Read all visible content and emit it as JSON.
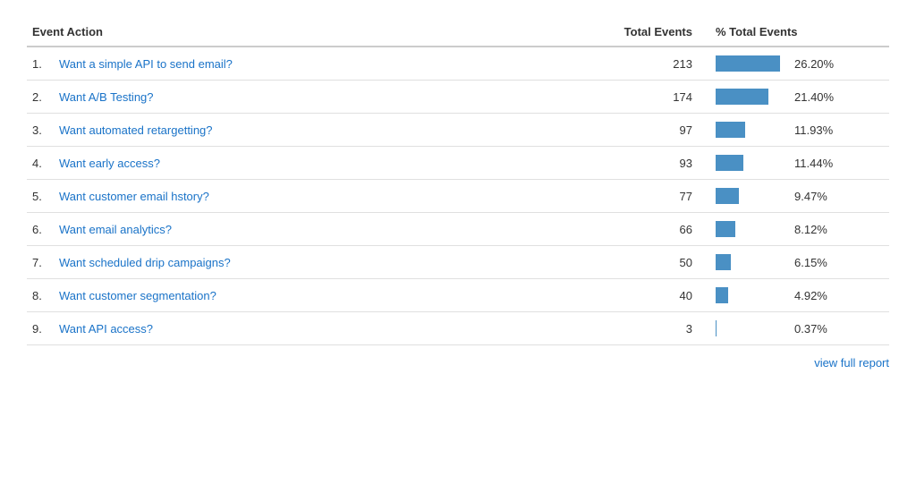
{
  "table": {
    "headers": {
      "action": "Event Action",
      "total": "Total Events",
      "pct": "% Total Events"
    },
    "rows": [
      {
        "rank": "1.",
        "action": "Want a simple API to send email?",
        "total": "213",
        "pct": "26.20%",
        "bar_pct": 100
      },
      {
        "rank": "2.",
        "action": "Want A/B Testing?",
        "total": "174",
        "pct": "21.40%",
        "bar_pct": 81.7
      },
      {
        "rank": "3.",
        "action": "Want automated retargetting?",
        "total": "97",
        "pct": "11.93%",
        "bar_pct": 45.5
      },
      {
        "rank": "4.",
        "action": "Want early access?",
        "total": "93",
        "pct": "11.44%",
        "bar_pct": 43.7
      },
      {
        "rank": "5.",
        "action": "Want customer email hstory?",
        "total": "77",
        "pct": "9.47%",
        "bar_pct": 36.2
      },
      {
        "rank": "6.",
        "action": "Want email analytics?",
        "total": "66",
        "pct": "8.12%",
        "bar_pct": 31.0
      },
      {
        "rank": "7.",
        "action": "Want scheduled drip campaigns?",
        "total": "50",
        "pct": "6.15%",
        "bar_pct": 23.5
      },
      {
        "rank": "8.",
        "action": "Want customer segmentation?",
        "total": "40",
        "pct": "4.92%",
        "bar_pct": 18.8
      },
      {
        "rank": "9.",
        "action": "Want API access?",
        "total": "3",
        "pct": "0.37%",
        "bar_pct": 1.4
      }
    ],
    "max_bar_width": 72
  },
  "footer": {
    "link_label": "view full report"
  }
}
